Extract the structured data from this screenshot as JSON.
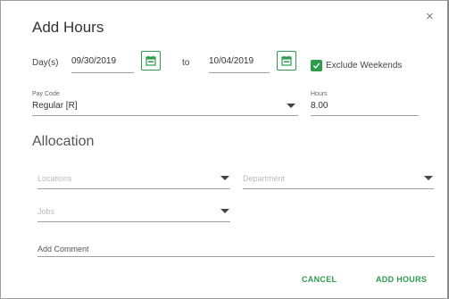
{
  "dialog": {
    "title": "Add Hours",
    "close_glyph": "×"
  },
  "dates": {
    "days_label": "Day(s)",
    "start_date": "09/30/2019",
    "to_label": "to",
    "end_date": "10/04/2019",
    "exclude_weekends_label": "Exclude Weekends",
    "exclude_weekends_checked": true
  },
  "pay": {
    "pay_code_label": "Pay Code",
    "pay_code_value": "Regular [R]",
    "hours_label": "Hours",
    "hours_value": "8.00"
  },
  "allocation": {
    "title": "Allocation",
    "locations_placeholder": "Locations",
    "department_placeholder": "Department",
    "jobs_placeholder": "Jobs",
    "comment_placeholder": "Add Comment"
  },
  "actions": {
    "cancel_label": "CANCEL",
    "add_hours_label": "ADD HOURS"
  },
  "colors": {
    "accent": "#2e9b4d"
  },
  "icons": {
    "calendar": "calendar-icon",
    "close": "close-icon",
    "check": "check-icon",
    "dropdown": "dropdown-caret-icon"
  }
}
